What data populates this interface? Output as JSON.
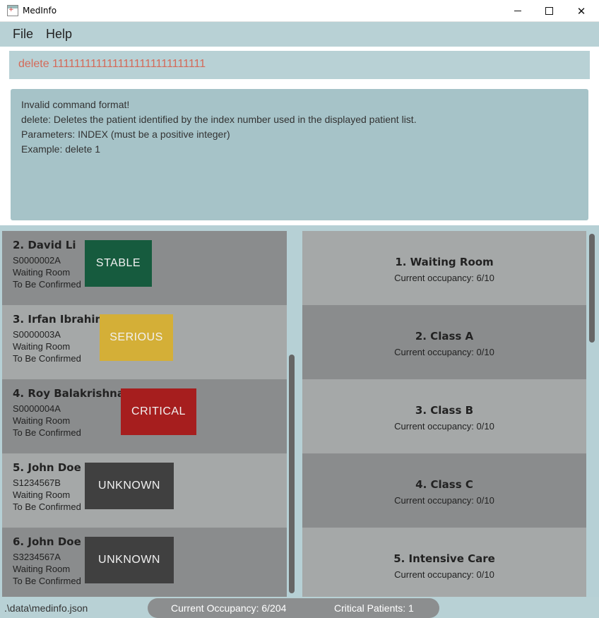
{
  "window": {
    "title": "MedInfo",
    "icon": "medinfo-app-icon",
    "minimize_icon": "minimize-icon",
    "maximize_icon": "maximize-icon",
    "close_icon": "close-icon",
    "close_glyph": "✕"
  },
  "menu": {
    "items": [
      {
        "label": "File"
      },
      {
        "label": "Help"
      }
    ]
  },
  "command": {
    "value": "delete 1111111111111111111111111111"
  },
  "result": {
    "lines": [
      "Invalid command format!",
      "delete: Deletes the patient identified by the index number used in the displayed patient list.",
      "Parameters: INDEX (must be a positive integer)",
      "Example: delete 1"
    ]
  },
  "patients": [
    {
      "name": "2.  David Li",
      "id": "S0000002A",
      "room": "Waiting Room",
      "ward": "To Be Confirmed",
      "status": "STABLE",
      "status_color": "#165b3e",
      "card_color": "#8a8c8d"
    },
    {
      "name": "3.  Irfan Ibrahim",
      "id": "S0000003A",
      "room": "Waiting Room",
      "ward": "To Be Confirmed",
      "status": "SERIOUS",
      "status_color": "#d4af37",
      "card_color": "#a5a8a8"
    },
    {
      "name": "4.  Roy Balakrishnan",
      "id": "S0000004A",
      "room": "Waiting Room",
      "ward": "To Be Confirmed",
      "status": "CRITICAL",
      "status_color": "#a61e1e",
      "card_color": "#8a8c8d"
    },
    {
      "name": "5.  John Doe",
      "id": "S1234567B",
      "room": "Waiting Room",
      "ward": "To Be Confirmed",
      "status": "UNKNOWN",
      "status_color": "#404040",
      "card_color": "#a5a8a8"
    },
    {
      "name": "6.  John Doe",
      "id": "S3234567A",
      "room": "Waiting Room",
      "ward": "To Be Confirmed",
      "status": "UNKNOWN",
      "status_color": "#404040",
      "card_color": "#8a8c8d"
    }
  ],
  "rooms": [
    {
      "name": "1.  Waiting Room",
      "occupancy": "Current occupancy: 6/10",
      "card_color": "#a5a8a8"
    },
    {
      "name": "2.  Class A",
      "occupancy": "Current occupancy: 0/10",
      "card_color": "#8a8c8d"
    },
    {
      "name": "3.  Class B",
      "occupancy": "Current occupancy: 0/10",
      "card_color": "#a5a8a8"
    },
    {
      "name": "4.  Class C",
      "occupancy": "Current occupancy: 0/10",
      "card_color": "#8a8c8d"
    },
    {
      "name": "5.  Intensive Care",
      "occupancy": "Current occupancy: 0/10",
      "card_color": "#a5a8a8"
    }
  ],
  "status_bar": {
    "file_path": ".\\data\\medinfo.json",
    "current_occupancy": "Current Occupancy: 6/204",
    "critical_patients": "Critical Patients: 1"
  }
}
